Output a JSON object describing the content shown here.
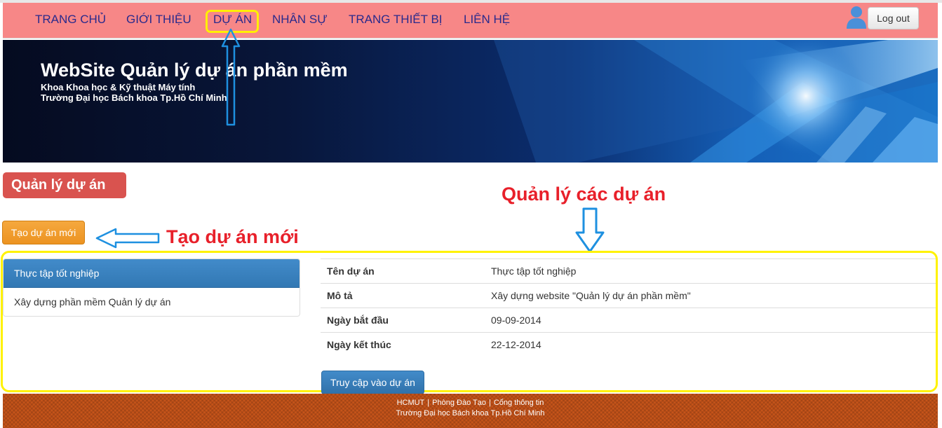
{
  "nav": {
    "items": [
      {
        "label": "TRANG CHỦ"
      },
      {
        "label": "GIỚI THIỆU"
      },
      {
        "label": "DỰ ÁN"
      },
      {
        "label": "NHÂN SỰ"
      },
      {
        "label": "TRANG THIẾT BỊ"
      },
      {
        "label": "LIÊN HỆ"
      }
    ],
    "logout_label": "Log out"
  },
  "banner": {
    "title": "WebSite Quản lý dự án phần mềm",
    "line1": "Khoa Khoa học & Kỹ thuật Máy tính",
    "line2": "Trường Đại học Bách khoa Tp.Hồ Chí Minh"
  },
  "page_heading": "Quản lý dự án",
  "create_button": "Tạo dự án mới",
  "annotations": {
    "manage": "Quản lý các dự án",
    "create": "Tạo dự án mới"
  },
  "projects": [
    {
      "name": "Thực tập tốt nghiệp",
      "active": true
    },
    {
      "name": "Xây dựng phần mềm Quản lý dự án",
      "active": false
    }
  ],
  "details": [
    {
      "label": "Tên dự án",
      "value": "Thực tập tốt nghiệp"
    },
    {
      "label": "Mô tả",
      "value": "Xây dựng website \"Quản lý dự án phần mềm\""
    },
    {
      "label": "Ngày bắt đầu",
      "value": "09-09-2014"
    },
    {
      "label": "Ngày kết thúc",
      "value": "22-12-2014"
    }
  ],
  "access_button": "Truy cập vào dự án",
  "footer": {
    "links": [
      "HCMUT",
      "Phòng Đào Tạo",
      "Cổng thông tin"
    ],
    "separator": "|",
    "line2": "Trường Đại học Bách khoa Tp.Hồ Chí Minh"
  },
  "colors": {
    "navbar": "#f78787",
    "nav_text": "#2a2a8c",
    "heading": "#d9534f",
    "create_button": "#f0ad4e",
    "primary": "#428bca",
    "annotation_text": "#e8202a",
    "annotation_arrow": "#1e90e0",
    "highlight": "#fff200",
    "footer": "#c8551a"
  },
  "icons": {
    "user": "user-icon",
    "arrow_up": "arrow-up-icon",
    "arrow_left": "arrow-left-icon",
    "arrow_down": "arrow-down-icon"
  }
}
